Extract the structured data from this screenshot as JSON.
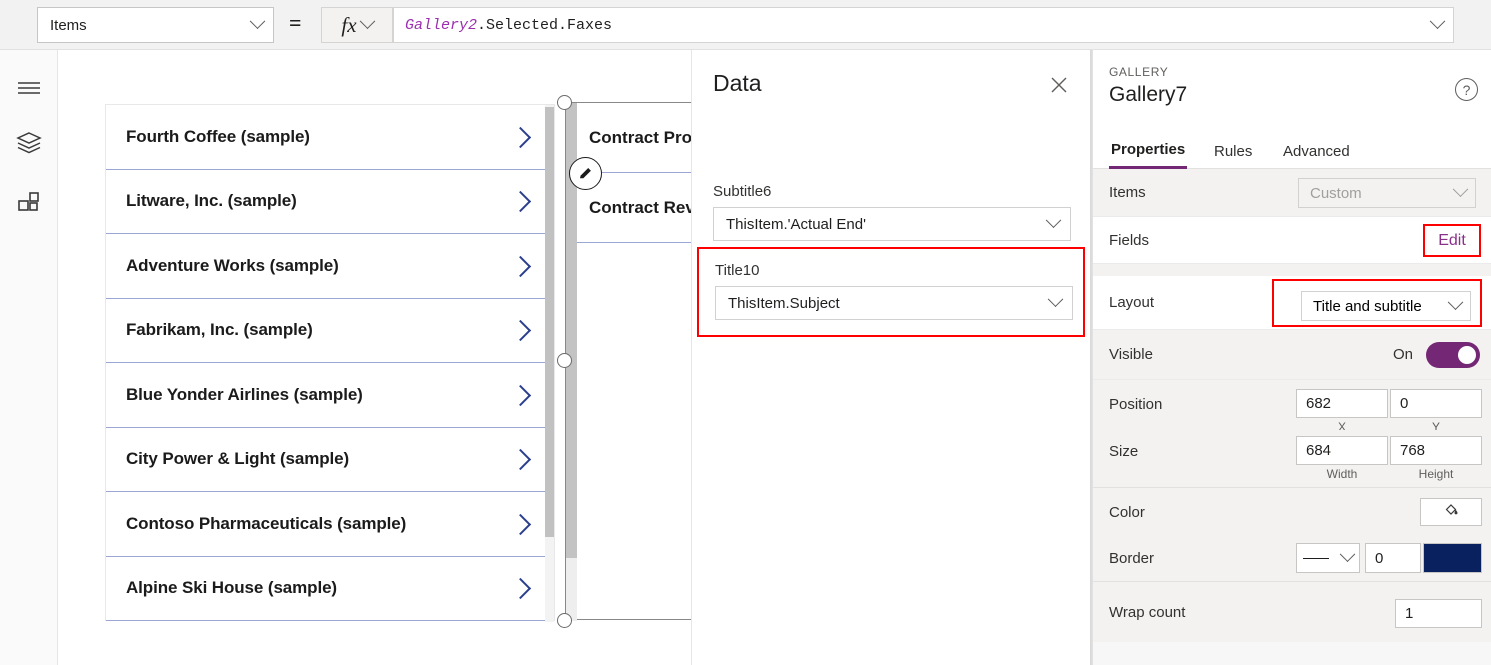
{
  "formula_bar": {
    "property_selected": "Items",
    "equals": "=",
    "fx_label": "fx",
    "formula_identifier": "Gallery2",
    "formula_rest": ".Selected.Faxes",
    "expand_icon": "chevron-down-icon"
  },
  "left_rail": {
    "items": [
      {
        "name": "hamburger-menu-icon",
        "label": "Menu"
      },
      {
        "name": "tree-view-icon",
        "label": "Tree view"
      },
      {
        "name": "insert-components-icon",
        "label": "Insert"
      }
    ]
  },
  "canvas": {
    "gallery1": {
      "rows": [
        "Fourth Coffee (sample)",
        "Litware, Inc. (sample)",
        "Adventure Works (sample)",
        "Fabrikam, Inc. (sample)",
        "Blue Yonder Airlines (sample)",
        "City Power & Light (sample)",
        "Contoso Pharmaceuticals (sample)",
        "Alpine Ski House (sample)"
      ],
      "chevron_icon": "chevron-right-icon"
    },
    "gallery2": {
      "selected": true,
      "edit_badge_icon": "pencil-edit-icon",
      "rows": [
        "Contract Pro",
        "Contract Rev",
        ""
      ]
    }
  },
  "data_panel": {
    "title": "Data",
    "close_icon": "close-icon",
    "fields": [
      {
        "label": "Subtitle6",
        "value": "ThisItem.'Actual End'",
        "highlighted": false,
        "chevron_icon": "chevron-down-icon"
      },
      {
        "label": "Title10",
        "value": "ThisItem.Subject",
        "highlighted": true,
        "chevron_icon": "chevron-down-icon"
      }
    ]
  },
  "properties_panel": {
    "control_kind": "GALLERY",
    "control_name": "Gallery7",
    "help_icon": "help-question-icon",
    "tabs": [
      {
        "label": "Properties",
        "active": true
      },
      {
        "label": "Rules",
        "active": false
      },
      {
        "label": "Advanced",
        "active": false
      }
    ],
    "rows": {
      "items": {
        "label": "Items",
        "value": "Custom",
        "disabled": true,
        "chevron_icon": "chevron-down-icon"
      },
      "fields": {
        "label": "Fields",
        "action_label": "Edit",
        "highlighted": true
      },
      "layout": {
        "label": "Layout",
        "value": "Title and subtitle",
        "highlighted": true,
        "chevron_icon": "chevron-down-icon"
      },
      "visible": {
        "label": "Visible",
        "state_label": "On",
        "on": true
      },
      "position": {
        "label": "Position",
        "x": "682",
        "y": "0",
        "x_caption": "X",
        "y_caption": "Y"
      },
      "size": {
        "label": "Size",
        "width": "684",
        "height": "768",
        "width_caption": "Width",
        "height_caption": "Height"
      },
      "color": {
        "label": "Color",
        "swatch_icon": "paint-bucket-icon"
      },
      "border": {
        "label": "Border",
        "style": "solid-line",
        "width": "0",
        "color_hex": "#0a2160"
      },
      "wrap_count": {
        "label": "Wrap count",
        "value": "1"
      }
    }
  },
  "colors": {
    "accent_purple": "#742774",
    "highlight_red": "#ff0000",
    "chevron_blue": "#2b3f8c",
    "border_navy": "#0a2160"
  }
}
